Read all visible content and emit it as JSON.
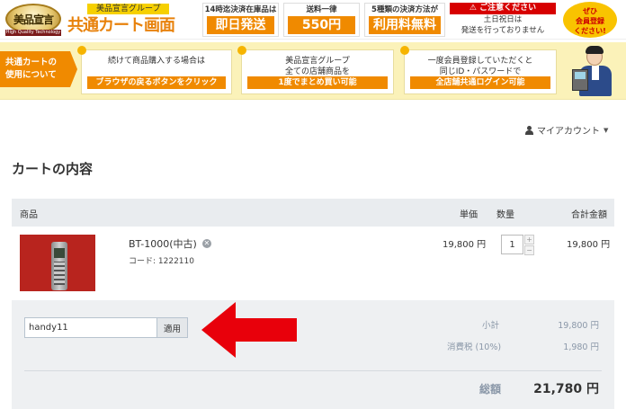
{
  "banner": {
    "logo_text": "美品宣言",
    "logo_ribbon": "High Quality Technology",
    "group_label": "美品宣言グループ",
    "title": "共通カート画面",
    "info1_small": "14時迄決済在庫品は",
    "info1_big": "即日発送",
    "info2_small": "送料一律",
    "info2_big": "550円",
    "info3_small": "5種類の決済方法が",
    "info3_big": "利用料無料",
    "notice_head": "ご注意ください",
    "notice_line1": "土日祝日は",
    "notice_line2": "発送を行っておりません",
    "member_line1": "ぜひ",
    "member_line2": "会員登録",
    "member_line3": "ください!"
  },
  "howto": {
    "label_line1": "共通カートの",
    "label_line2": "使用について",
    "cards": [
      {
        "line1": "続けて商品購入する場合は",
        "line2": "",
        "bar": "ブラウザの戻るボタンをクリック"
      },
      {
        "line1": "美品宣言グループ",
        "line2": "全ての店舗商品を",
        "bar": "1度でまとめ買い可能"
      },
      {
        "line1": "一度会員登録していただくと",
        "line2": "同じID・パスワードで",
        "bar": "全店舗共通ログイン可能"
      }
    ]
  },
  "account": {
    "label": "マイアカウント"
  },
  "cart": {
    "title": "カートの内容",
    "headers": {
      "product": "商品",
      "price": "単価",
      "qty": "数量",
      "total": "合計金額"
    },
    "item": {
      "name": "BT-1000(中古)",
      "code": "コード: 1222110",
      "unit_price": "19,800 円",
      "qty": "1",
      "line_total": "19,800 円"
    },
    "coupon": {
      "value": "handy11",
      "apply_label": "適用"
    },
    "summary": {
      "subtotal_label": "小計",
      "subtotal_value": "19,800 円",
      "tax_label": "消費税 (10%)",
      "tax_value": "1,980 円",
      "total_label": "総額",
      "total_value": "21,780 円"
    }
  },
  "colors": {
    "accent": "#f08a00",
    "arrow": "#e8000b",
    "notice": "#d70000"
  }
}
